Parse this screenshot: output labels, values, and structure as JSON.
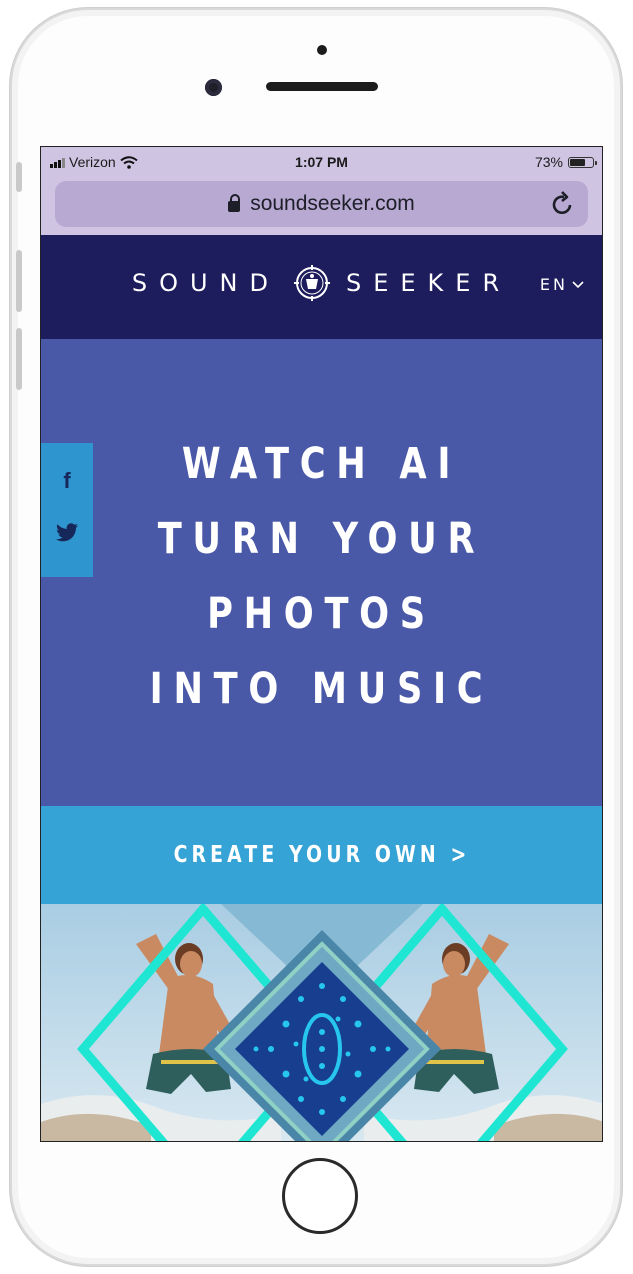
{
  "status_bar": {
    "carrier": "Verizon",
    "time": "1:07 PM",
    "battery_percent": "73%",
    "battery_level": 0.73
  },
  "browser": {
    "url": "soundseeker.com",
    "lock_icon": "lock-icon",
    "reload_icon": "reload-icon"
  },
  "header": {
    "logo_left": "SOUND",
    "logo_right": "SEEKER",
    "language": "EN"
  },
  "social": {
    "facebook_glyph": "f",
    "items": [
      "facebook-icon",
      "twitter-icon"
    ]
  },
  "hero": {
    "lines": [
      "WATCH AI",
      "TURN YOUR",
      "PHOTOS",
      "INTO MUSIC"
    ]
  },
  "cta": {
    "label": "CREATE YOUR OWN >"
  },
  "colors": {
    "header_bg": "#1d1c5c",
    "hero_bg": "#4a58a8",
    "cta_bg": "#35a3d6",
    "social_bg": "#2f95cf",
    "browser_chrome": "#cfc5e3",
    "accent_turquoise": "#1fe6d2"
  }
}
